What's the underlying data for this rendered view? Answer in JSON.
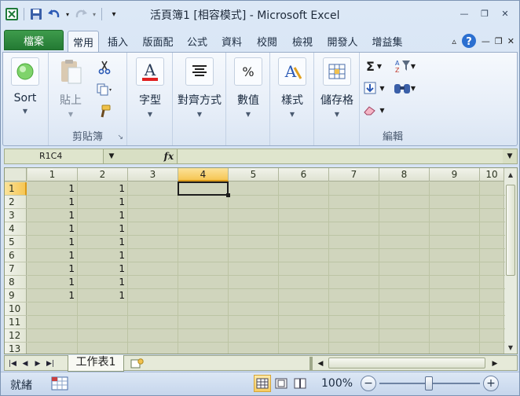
{
  "window": {
    "title": "活頁簿1  [相容模式] - Microsoft Excel",
    "minimize_glyph": "—",
    "restore_glyph": "❐",
    "close_glyph": "✕"
  },
  "tabs": {
    "file": "檔案",
    "items": [
      "常用",
      "插入",
      "版面配",
      "公式",
      "資料",
      "校閱",
      "檢視",
      "開發人",
      "增益集"
    ],
    "active": "常用"
  },
  "ribbon": {
    "sort_label": "Sort",
    "paste_label": "貼上",
    "clipboard_group": "剪貼簿",
    "font_label": "字型",
    "align_label": "對齊方式",
    "number_label": "數值",
    "styles_label": "樣式",
    "cells_label": "儲存格",
    "editing_group": "編輯",
    "sigma_glyph": "Σ",
    "percent_glyph": "%",
    "font_glyph": "A"
  },
  "formula_bar": {
    "name_box": "R1C4",
    "fx": "fx",
    "formula": ""
  },
  "grid": {
    "columns": [
      "1",
      "2",
      "3",
      "4",
      "5",
      "6",
      "7",
      "8",
      "9",
      "10"
    ],
    "rows": [
      "1",
      "2",
      "3",
      "4",
      "5",
      "6",
      "7",
      "8",
      "9",
      "10",
      "11",
      "12",
      "13"
    ],
    "selected_col": "4",
    "selected_row": "1",
    "values": [
      [
        "1",
        "1"
      ],
      [
        "1",
        "1"
      ],
      [
        "1",
        "1"
      ],
      [
        "1",
        "1"
      ],
      [
        "1",
        "1"
      ],
      [
        "1",
        "1"
      ],
      [
        "1",
        "1"
      ],
      [
        "1",
        "1"
      ],
      [
        "1",
        "1"
      ]
    ]
  },
  "sheets": {
    "tabs": [
      "工作表1"
    ]
  },
  "status": {
    "ready": "就緒",
    "zoom": "100%",
    "zoom_minus": "−",
    "zoom_plus": "+"
  }
}
